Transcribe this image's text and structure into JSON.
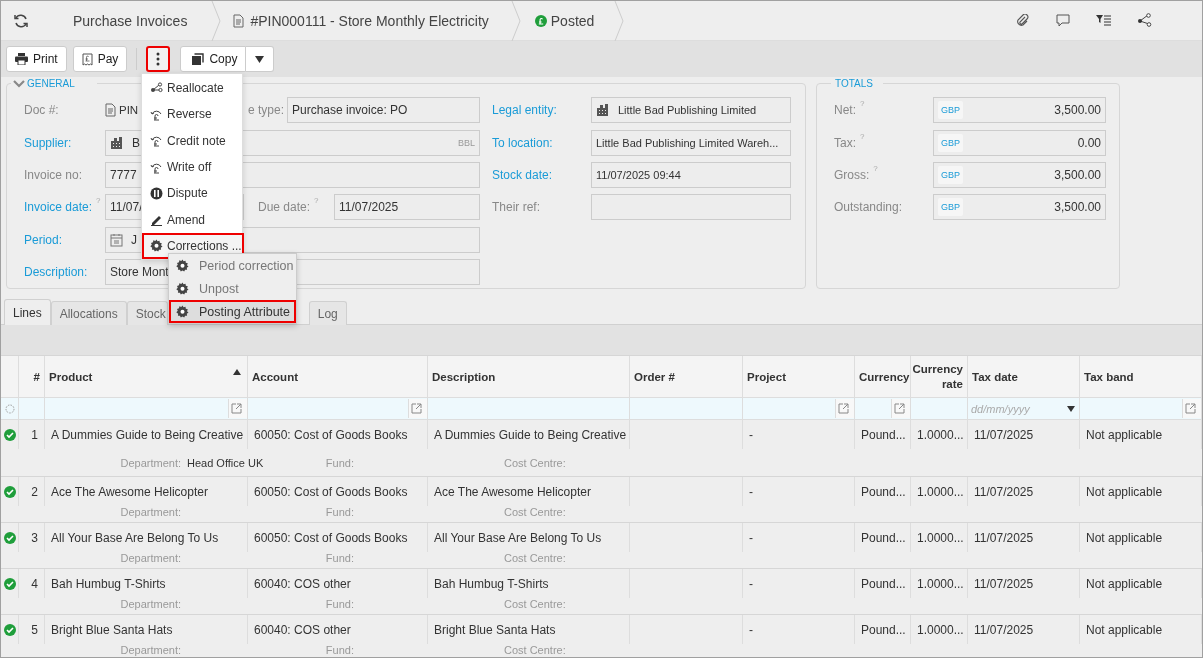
{
  "breadcrumb": [
    {
      "kind": "link",
      "label": "Purchase Invoices"
    },
    {
      "kind": "document",
      "label": "#PIN000111 - Store Monthly Electricity"
    },
    {
      "kind": "status",
      "label": "Posted"
    }
  ],
  "toolbar": [
    {
      "kind": "print",
      "label": "Print",
      "highlighted": false
    },
    {
      "kind": "pay",
      "label": "Pay",
      "highlighted": false
    },
    {
      "kind": "more",
      "highlighted": true
    },
    {
      "kind": "copy",
      "label": "Copy",
      "highlighted": false
    }
  ],
  "general": {
    "title": "GENERAL",
    "left": [
      {
        "kind": "doc",
        "label": "Doc #:",
        "link": false,
        "value": "PIN",
        "extra": {
          "label": "e type:",
          "value": "Purchase invoice: PO"
        }
      },
      {
        "kind": "plain",
        "label": "Supplier:",
        "link": true,
        "value": "B",
        "suffix": "BBL"
      },
      {
        "kind": "plain",
        "label": "Invoice no:",
        "link": false,
        "value": "7777"
      },
      {
        "kind": "date",
        "label": "Invoice date:",
        "link": true,
        "help": "?",
        "value": "11/07/",
        "extra": {
          "label": "Due date:",
          "help": "?",
          "value": "11/07/2025"
        }
      },
      {
        "kind": "plain",
        "label": "Period:",
        "link": true,
        "value": "J"
      },
      {
        "kind": "plain",
        "label": "Description:",
        "link": true,
        "value": "Store Mont"
      }
    ],
    "right": [
      {
        "label": "Legal entity:",
        "link": true,
        "value": "Little Bad Publishing Limited"
      },
      {
        "label": "To location:",
        "link": true,
        "value": "Little Bad Publishing Limited Wareh..."
      },
      {
        "label": "Stock date:",
        "link": true,
        "value": "11/07/2025 09:44"
      },
      {
        "label": "Their ref:",
        "link": false
      }
    ]
  },
  "totals": {
    "title": "TOTALS",
    "rows": [
      {
        "label": "Net:",
        "help": "?",
        "currency": "GBP",
        "value": "3,500.00"
      },
      {
        "label": "Tax:",
        "help": "?",
        "currency": "GBP",
        "value": "0.00"
      },
      {
        "label": "Gross:",
        "help": "?",
        "currency": "GBP",
        "value": "3,500.00"
      },
      {
        "label": "Outstanding:",
        "currency": "GBP",
        "value": "3,500.00"
      }
    ]
  },
  "menu": [
    {
      "label": "Reallocate",
      "highlighted": false
    },
    {
      "label": "Reverse",
      "highlighted": false
    },
    {
      "label": "Credit note",
      "highlighted": false
    },
    {
      "label": "Write off",
      "highlighted": false
    },
    {
      "label": "Dispute",
      "highlighted": false
    },
    {
      "label": "Amend",
      "highlighted": false
    },
    {
      "label": "Corrections ...",
      "highlighted": true
    }
  ],
  "submenu": [
    {
      "label": "Period correction",
      "highlighted": false
    },
    {
      "label": "Unpost",
      "highlighted": false
    },
    {
      "label": "Posting Attribute",
      "highlighted": true
    }
  ],
  "tabs": [
    {
      "label": "Lines",
      "selected": true
    },
    {
      "label": "Allocations",
      "selected": false
    },
    {
      "label": "Stock",
      "selected": false
    },
    {
      "label": "Log",
      "selected": false
    }
  ],
  "table": {
    "columns": [
      {
        "label": "#",
        "filter_button": false
      },
      {
        "label": "Product",
        "sorted": true,
        "filter_button": true
      },
      {
        "label": "Account",
        "filter_button": true
      },
      {
        "label": "Description",
        "filter_button": false
      },
      {
        "label": "Order #",
        "filter_button": false
      },
      {
        "label": "Project",
        "filter_button": true
      },
      {
        "label": "Currency",
        "filter_button": true
      },
      {
        "label": "Currency rate",
        "filter_button": false
      },
      {
        "label": "Tax date",
        "filter_button": false,
        "filter_placeholder": "dd/mm/yyyy"
      },
      {
        "label": "Tax band",
        "filter_button": true
      }
    ],
    "rows": [
      {
        "complete": true,
        "number": "1",
        "product": "A Dummies Guide to Being Creative",
        "account": "60050: Cost of Goods Books",
        "description": "A Dummies Guide to Being Creative",
        "project": "-",
        "currency": "Pound...",
        "currency_rate": "1.0000...",
        "tax_date": "11/07/2025",
        "tax_band": "Not applicable",
        "details": [
          {
            "label": "Department:",
            "value": "Head Office UK"
          },
          {
            "label": "Fund:"
          },
          {
            "label": "Cost Centre:"
          }
        ]
      },
      {
        "complete": true,
        "number": "2",
        "product": "Ace The Awesome Helicopter",
        "account": "60050: Cost of Goods Books",
        "description": "Ace The Awesome Helicopter",
        "project": "-",
        "currency": "Pound...",
        "currency_rate": "1.0000...",
        "tax_date": "11/07/2025",
        "tax_band": "Not applicable",
        "details": [
          {
            "label": "Department:"
          },
          {
            "label": "Fund:"
          },
          {
            "label": "Cost Centre:"
          }
        ]
      },
      {
        "complete": true,
        "number": "3",
        "product": "All Your Base Are Belong To Us",
        "account": "60050: Cost of Goods Books",
        "description": "All Your Base Are Belong To Us",
        "project": "-",
        "currency": "Pound...",
        "currency_rate": "1.0000...",
        "tax_date": "11/07/2025",
        "tax_band": "Not applicable",
        "details": [
          {
            "label": "Department:"
          },
          {
            "label": "Fund:"
          },
          {
            "label": "Cost Centre:"
          }
        ]
      },
      {
        "complete": true,
        "number": "4",
        "product": "Bah Humbug T-Shirts",
        "account": "60040: COS other",
        "description": "Bah Humbug T-Shirts",
        "project": "-",
        "currency": "Pound...",
        "currency_rate": "1.0000...",
        "tax_date": "11/07/2025",
        "tax_band": "Not applicable",
        "details": [
          {
            "label": "Department:"
          },
          {
            "label": "Fund:"
          },
          {
            "label": "Cost Centre:"
          }
        ]
      },
      {
        "complete": true,
        "number": "5",
        "product": "Bright Blue Santa Hats",
        "account": "60040: COS other",
        "description": "Bright Blue Santa Hats",
        "project": "-",
        "currency": "Pound...",
        "currency_rate": "1.0000...",
        "tax_date": "11/07/2025",
        "tax_band": "Not applicable",
        "details": [
          {
            "label": "Department:"
          },
          {
            "label": "Fund:"
          },
          {
            "label": "Cost Centre:"
          }
        ]
      }
    ]
  }
}
